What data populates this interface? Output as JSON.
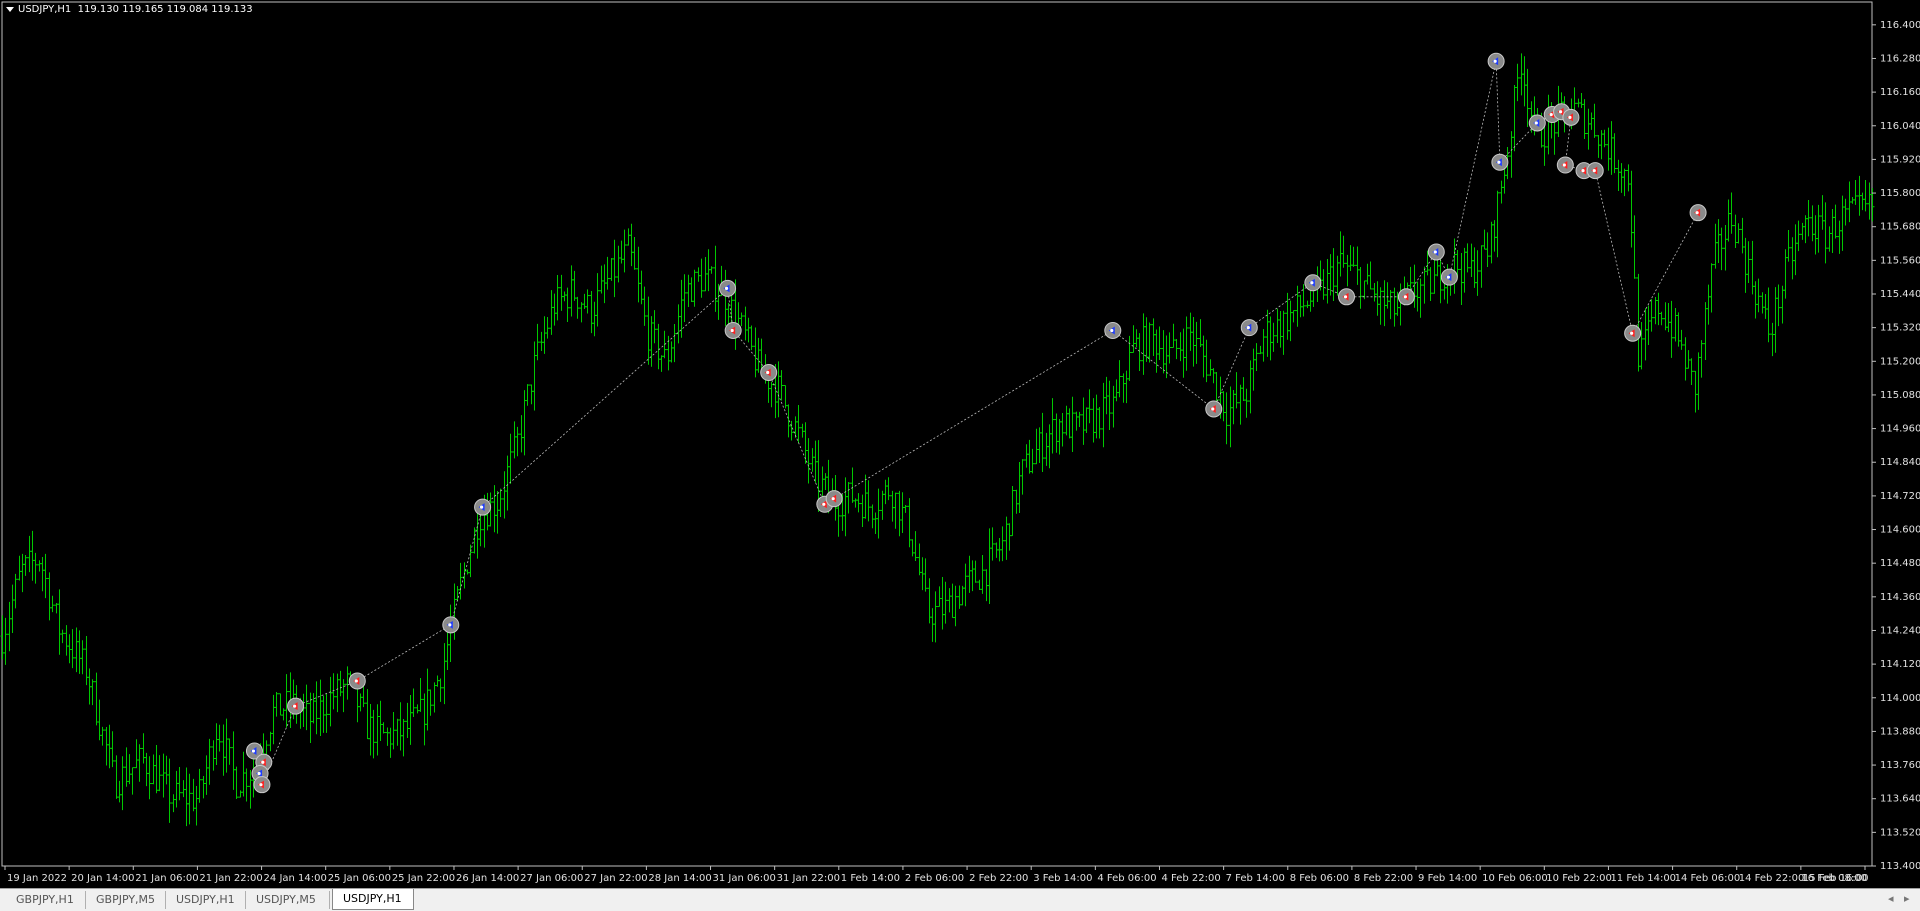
{
  "window": {
    "symbol_label": "USDJPY,H1",
    "ohlc_label": "119.130 119.165 119.084 119.133"
  },
  "chart_data": {
    "type": "ohlc-bar",
    "symbol": "USDJPY",
    "timeframe": "H1",
    "bar_color": "#00c800",
    "background": "#000000",
    "ylim": [
      113.4,
      116.46
    ],
    "y_ticks": [
      "116.400",
      "116.280",
      "116.160",
      "116.040",
      "115.920",
      "115.800",
      "115.680",
      "115.560",
      "115.440",
      "115.320",
      "115.200",
      "115.080",
      "114.960",
      "114.840",
      "114.720",
      "114.600",
      "114.480",
      "114.360",
      "114.240",
      "114.120",
      "114.000",
      "113.880",
      "113.760",
      "113.640",
      "113.520",
      "113.400"
    ],
    "x_ticks": [
      "19 Jan 2022",
      "20 Jan 14:00",
      "21 Jan 06:00",
      "21 Jan 22:00",
      "24 Jan 14:00",
      "25 Jan 06:00",
      "25 Jan 22:00",
      "26 Jan 14:00",
      "27 Jan 06:00",
      "27 Jan 22:00",
      "28 Jan 14:00",
      "31 Jan 06:00",
      "31 Jan 22:00",
      "1 Feb 14:00",
      "2 Feb 06:00",
      "2 Feb 22:00",
      "3 Feb 14:00",
      "4 Feb 06:00",
      "4 Feb 22:00",
      "7 Feb 14:00",
      "8 Feb 06:00",
      "8 Feb 22:00",
      "9 Feb 14:00",
      "10 Feb 06:00",
      "10 Feb 22:00",
      "11 Feb 14:00",
      "14 Feb 06:00",
      "14 Feb 22:00",
      "15 Feb 16:00",
      "16 Feb 08:00"
    ],
    "price_path": [
      [
        0,
        114.22
      ],
      [
        0.01,
        114.45
      ],
      [
        0.02,
        114.5
      ],
      [
        0.03,
        114.25
      ],
      [
        0.045,
        114.1
      ],
      [
        0.06,
        113.7
      ],
      [
        0.075,
        113.78
      ],
      [
        0.09,
        113.65
      ],
      [
        0.105,
        113.64
      ],
      [
        0.115,
        113.9
      ],
      [
        0.125,
        113.7
      ],
      [
        0.135,
        113.75
      ],
      [
        0.145,
        113.95
      ],
      [
        0.155,
        113.98
      ],
      [
        0.165,
        113.92
      ],
      [
        0.175,
        114.0
      ],
      [
        0.185,
        114.05
      ],
      [
        0.195,
        113.9
      ],
      [
        0.205,
        113.86
      ],
      [
        0.215,
        113.88
      ],
      [
        0.225,
        113.95
      ],
      [
        0.235,
        114.1
      ],
      [
        0.245,
        114.4
      ],
      [
        0.255,
        114.65
      ],
      [
        0.265,
        114.7
      ],
      [
        0.275,
        114.9
      ],
      [
        0.285,
        115.2
      ],
      [
        0.295,
        115.4
      ],
      [
        0.305,
        115.45
      ],
      [
        0.315,
        115.38
      ],
      [
        0.325,
        115.5
      ],
      [
        0.335,
        115.6
      ],
      [
        0.345,
        115.3
      ],
      [
        0.355,
        115.2
      ],
      [
        0.365,
        115.45
      ],
      [
        0.375,
        115.5
      ],
      [
        0.385,
        115.45
      ],
      [
        0.395,
        115.32
      ],
      [
        0.405,
        115.17
      ],
      [
        0.415,
        115.1
      ],
      [
        0.425,
        114.95
      ],
      [
        0.435,
        114.78
      ],
      [
        0.445,
        114.7
      ],
      [
        0.455,
        114.72
      ],
      [
        0.465,
        114.68
      ],
      [
        0.475,
        114.75
      ],
      [
        0.485,
        114.6
      ],
      [
        0.495,
        114.3
      ],
      [
        0.505,
        114.32
      ],
      [
        0.515,
        114.4
      ],
      [
        0.525,
        114.45
      ],
      [
        0.535,
        114.55
      ],
      [
        0.545,
        114.8
      ],
      [
        0.555,
        114.9
      ],
      [
        0.565,
        114.98
      ],
      [
        0.575,
        114.96
      ],
      [
        0.585,
        115.0
      ],
      [
        0.595,
        115.05
      ],
      [
        0.605,
        115.25
      ],
      [
        0.615,
        115.28
      ],
      [
        0.625,
        115.22
      ],
      [
        0.635,
        115.3
      ],
      [
        0.645,
        115.18
      ],
      [
        0.655,
        115.02
      ],
      [
        0.665,
        115.08
      ],
      [
        0.675,
        115.3
      ],
      [
        0.685,
        115.34
      ],
      [
        0.695,
        115.4
      ],
      [
        0.705,
        115.45
      ],
      [
        0.715,
        115.55
      ],
      [
        0.725,
        115.5
      ],
      [
        0.735,
        115.42
      ],
      [
        0.745,
        115.38
      ],
      [
        0.755,
        115.45
      ],
      [
        0.765,
        115.48
      ],
      [
        0.775,
        115.55
      ],
      [
        0.785,
        115.52
      ],
      [
        0.795,
        115.6
      ],
      [
        0.805,
        115.95
      ],
      [
        0.812,
        116.28
      ],
      [
        0.82,
        116.0
      ],
      [
        0.83,
        116.05
      ],
      [
        0.84,
        116.1
      ],
      [
        0.85,
        116.05
      ],
      [
        0.86,
        115.95
      ],
      [
        0.87,
        115.85
      ],
      [
        0.875,
        115.2
      ],
      [
        0.885,
        115.4
      ],
      [
        0.895,
        115.3
      ],
      [
        0.905,
        115.1
      ],
      [
        0.915,
        115.55
      ],
      [
        0.925,
        115.72
      ],
      [
        0.935,
        115.5
      ],
      [
        0.945,
        115.3
      ],
      [
        0.955,
        115.55
      ],
      [
        0.965,
        115.7
      ],
      [
        0.975,
        115.65
      ],
      [
        0.985,
        115.72
      ],
      [
        1,
        115.75
      ]
    ],
    "trade_markers": [
      {
        "t": 0.135,
        "p": 113.81,
        "side": "buy"
      },
      {
        "t": 0.14,
        "p": 113.77,
        "side": "sell"
      },
      {
        "t": 0.138,
        "p": 113.73,
        "side": "buy"
      },
      {
        "t": 0.139,
        "p": 113.69,
        "side": "sell"
      },
      {
        "t": 0.157,
        "p": 113.97,
        "side": "sell"
      },
      {
        "t": 0.19,
        "p": 114.06,
        "side": "sell"
      },
      {
        "t": 0.24,
        "p": 114.26,
        "side": "buy"
      },
      {
        "t": 0.257,
        "p": 114.68,
        "side": "buy"
      },
      {
        "t": 0.388,
        "p": 115.46,
        "side": "buy"
      },
      {
        "t": 0.391,
        "p": 115.31,
        "side": "sell"
      },
      {
        "t": 0.41,
        "p": 115.16,
        "side": "sell"
      },
      {
        "t": 0.44,
        "p": 114.69,
        "side": "sell"
      },
      {
        "t": 0.445,
        "p": 114.71,
        "side": "sell"
      },
      {
        "t": 0.594,
        "p": 115.31,
        "side": "buy"
      },
      {
        "t": 0.648,
        "p": 115.03,
        "side": "sell"
      },
      {
        "t": 0.667,
        "p": 115.32,
        "side": "buy"
      },
      {
        "t": 0.701,
        "p": 115.48,
        "side": "buy"
      },
      {
        "t": 0.719,
        "p": 115.43,
        "side": "sell"
      },
      {
        "t": 0.751,
        "p": 115.43,
        "side": "sell"
      },
      {
        "t": 0.767,
        "p": 115.59,
        "side": "buy"
      },
      {
        "t": 0.774,
        "p": 115.5,
        "side": "buy"
      },
      {
        "t": 0.799,
        "p": 116.27,
        "side": "buy"
      },
      {
        "t": 0.801,
        "p": 115.91,
        "side": "buy"
      },
      {
        "t": 0.821,
        "p": 116.05,
        "side": "buy"
      },
      {
        "t": 0.829,
        "p": 116.08,
        "side": "sell"
      },
      {
        "t": 0.834,
        "p": 116.09,
        "side": "sell"
      },
      {
        "t": 0.839,
        "p": 116.07,
        "side": "sell"
      },
      {
        "t": 0.836,
        "p": 115.9,
        "side": "sell"
      },
      {
        "t": 0.846,
        "p": 115.88,
        "side": "sell"
      },
      {
        "t": 0.852,
        "p": 115.88,
        "side": "sell"
      },
      {
        "t": 0.872,
        "p": 115.3,
        "side": "sell"
      },
      {
        "t": 0.907,
        "p": 115.73,
        "side": "sell"
      }
    ],
    "grid": false,
    "legend": "none"
  },
  "tabs": [
    {
      "label": "GBPJPY,H1",
      "active": false
    },
    {
      "label": "GBPJPY,M5",
      "active": false
    },
    {
      "label": "USDJPY,H1",
      "active": false
    },
    {
      "label": "USDJPY,M5",
      "active": false
    },
    {
      "label": "USDJPY,H1",
      "active": true
    }
  ],
  "tab_scroll": {
    "left": "◂",
    "right": "▸"
  }
}
